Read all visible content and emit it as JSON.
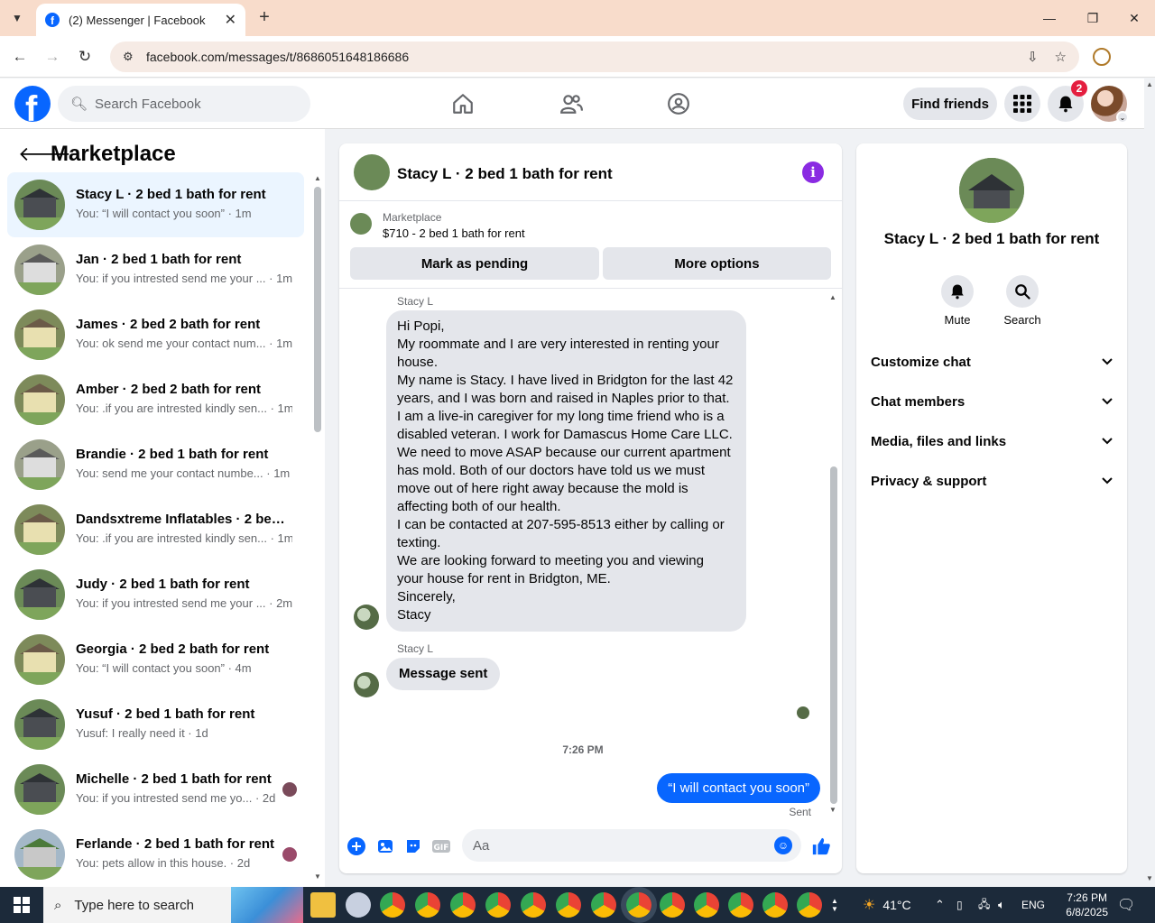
{
  "browser": {
    "tab_title": "(2) Messenger | Facebook",
    "url": "facebook.com/messages/t/8686051648186686"
  },
  "fb_header": {
    "search_placeholder": "Search Facebook",
    "find_friends": "Find friends",
    "notification_count": "2"
  },
  "left_panel": {
    "title": "Marketplace",
    "conversations": [
      {
        "name": "Stacy L · 2 bed 1 bath for rent",
        "preview": "You: “I will contact you soon” · 1m"
      },
      {
        "name": "Jan · 2 bed 1 bath for rent",
        "preview": "You: if you intrested send me your ... · 1m"
      },
      {
        "name": "James · 2 bed 2 bath for rent",
        "preview": "You: ok send me your contact num... · 1m"
      },
      {
        "name": "Amber · 2 bed 2 bath for rent",
        "preview": "You: .if you are intrested kindly sen... · 1m"
      },
      {
        "name": "Brandie · 2 bed 1 bath for rent",
        "preview": "You: send me your contact numbe... · 1m"
      },
      {
        "name": "Dandsxtreme Inflatables · 2 bed ...",
        "preview": "You: .if you are intrested kindly sen... · 1m"
      },
      {
        "name": "Judy · 2 bed 1 bath for rent",
        "preview": "You: if you intrested send me your ... · 2m"
      },
      {
        "name": "Georgia · 2 bed 2 bath for rent",
        "preview": "You: “I will contact you soon” · 4m"
      },
      {
        "name": "Yusuf · 2 bed 1 bath for rent",
        "preview": "Yusuf: I really need it · 1d"
      },
      {
        "name": "Michelle · 2 bed 1 bath for rent",
        "preview": "You: if you intrested send me yo... · 2d"
      },
      {
        "name": "Ferlande · 2 bed 1 bath for rent",
        "preview": "You: pets allow in this house. · 2d"
      }
    ]
  },
  "chat": {
    "title": "Stacy L · 2 bed 1 bath for rent",
    "marketplace_label": "Marketplace",
    "listing": "$710 - 2 bed 1 bath for rent",
    "mark_pending": "Mark as pending",
    "more_options": "More options",
    "sender_1": "Stacy L",
    "message_1": "Hi Popi,\nMy roommate and I are very interested in renting your\nhouse.\nMy name is Stacy.  I have lived in Bridgton for the last 42\nyears, and I was born and raised in Naples prior to that.\nI am a live-in caregiver for my long time friend who is a\ndisabled veteran. I work for Damascus Home Care LLC.\nWe need to move ASAP because our current apartment\nhas mold.  Both of our doctors have told us we must\nmove out of here right away because the mold is\naffecting both of our health.\nI can be contacted at 207-595-8513 either by calling or\ntexting.\nWe are looking forward to meeting you and viewing\nyour house for rent in Bridgton, ME.\nSincerely,\nStacy",
    "sender_2": "Stacy L",
    "message_2": "Message sent",
    "time_separator": "7:26 PM",
    "outgoing": "“I will contact you soon”",
    "sent_status": "Sent",
    "composer_placeholder": "Aa"
  },
  "right_panel": {
    "name": "Stacy L · 2 bed 1 bath for rent",
    "mute": "Mute",
    "search": "Search",
    "sections": [
      "Customize chat",
      "Chat members",
      "Media, files and links",
      "Privacy & support"
    ]
  },
  "taskbar": {
    "search_text": "Type here to search",
    "weather": "41°C",
    "language": "ENG",
    "time": "7:26 PM",
    "date": "6/8/2025"
  },
  "colors": {
    "fb_blue": "#0866ff",
    "info_purple": "#8a2be2",
    "badge_red": "#e41e3f"
  }
}
